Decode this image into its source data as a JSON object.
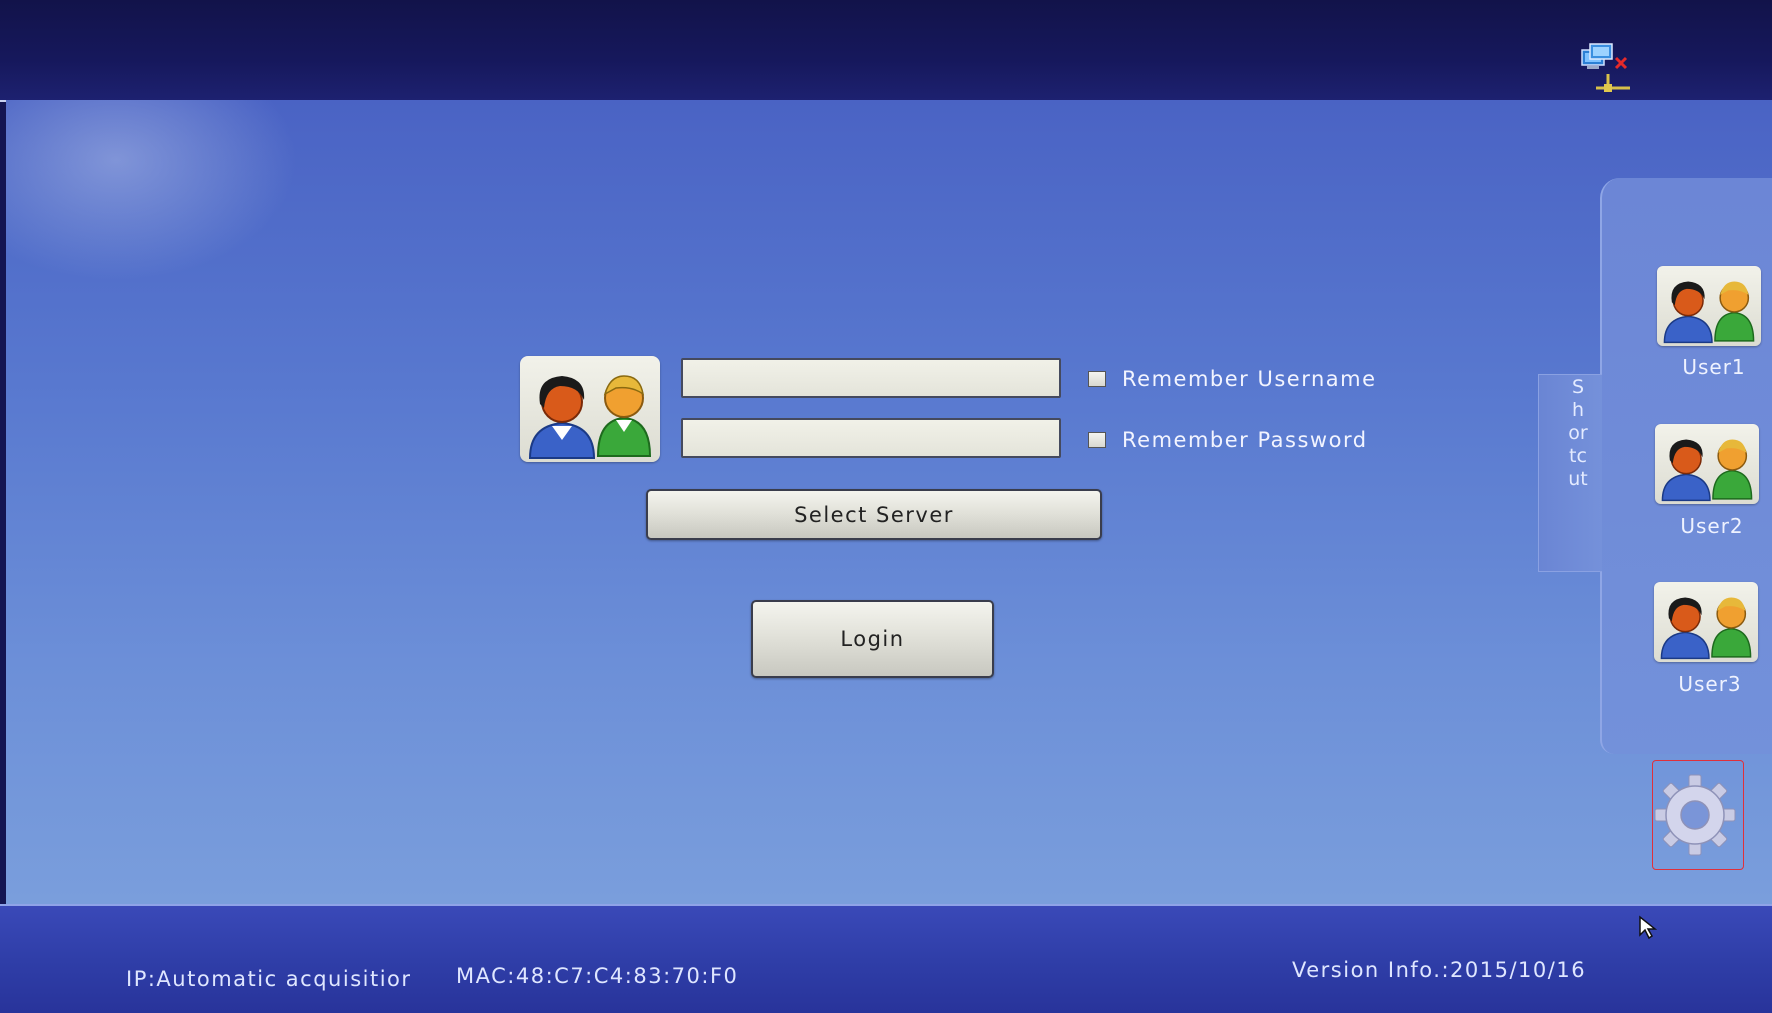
{
  "login_form": {
    "username_value": "",
    "password_value": "",
    "remember_username_label": "Remember Username",
    "remember_password_label": "Remember Password",
    "remember_username_checked": false,
    "remember_password_checked": false,
    "select_server_label": "Select Server",
    "login_label": "Login"
  },
  "shortcut_panel": {
    "tab_label": "Shortcut",
    "users": [
      {
        "label": "User1"
      },
      {
        "label": "User2"
      },
      {
        "label": "User3"
      }
    ]
  },
  "status_bar": {
    "ip_text": "IP:Automatic acquisitior",
    "mac_text": "MAC:48:C7:C4:83:70:F0",
    "version_text": "Version Info.:2015/10/16"
  },
  "icons": {
    "network": "network-disconnected-icon",
    "settings": "gear-icon",
    "user_avatar": "users-avatar-icon",
    "cursor": "mouse-pointer-icon"
  },
  "colors": {
    "desktop_top": "#4a63c4",
    "desktop_bottom": "#7a9edc",
    "top_bar": "#16185c",
    "bottom_bar": "#2f3ea8",
    "settings_highlight": "#e0303a"
  }
}
